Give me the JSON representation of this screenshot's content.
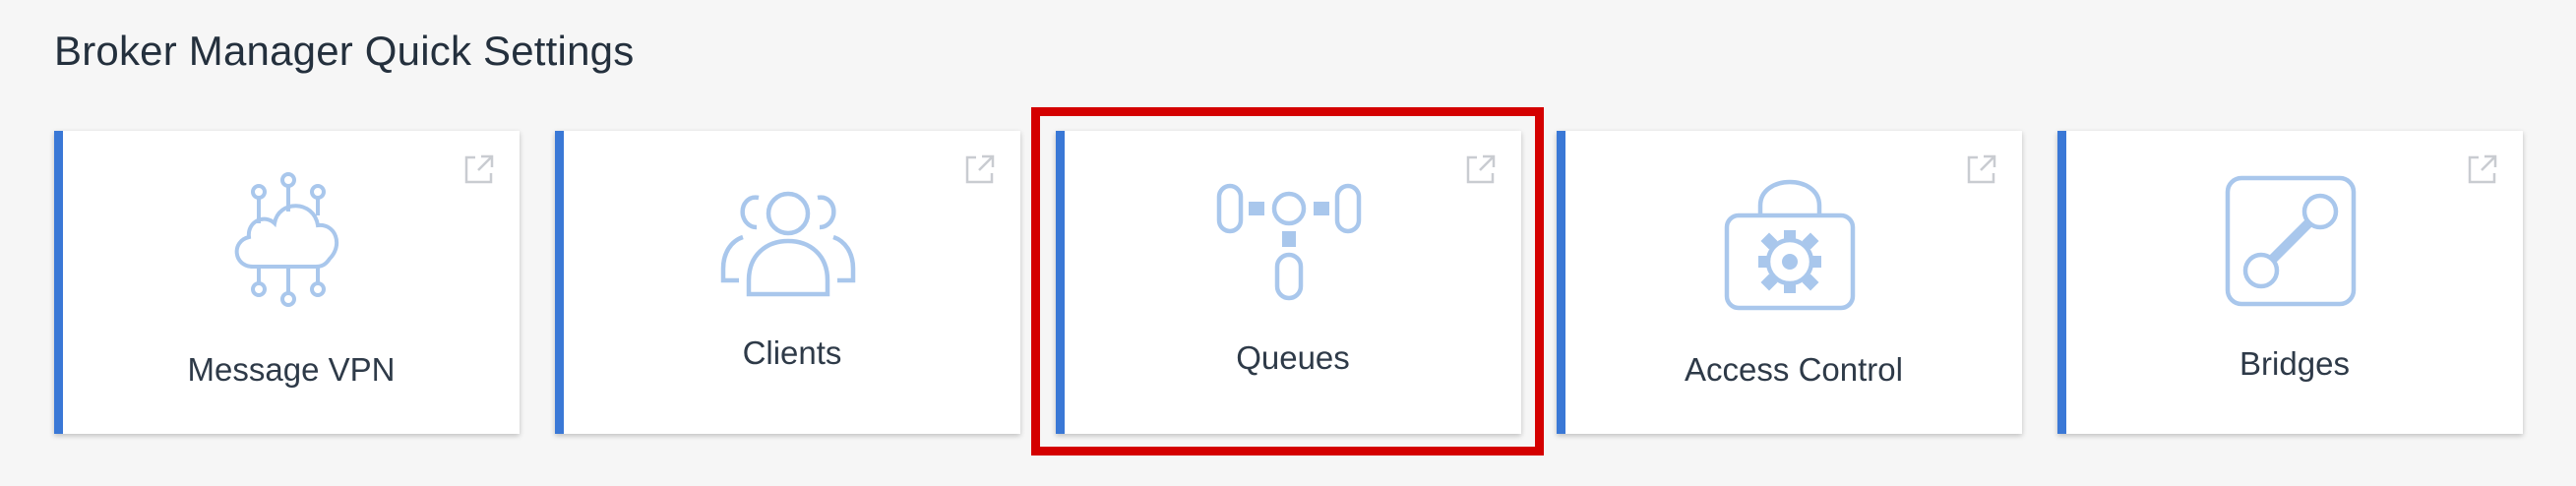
{
  "section": {
    "title": "Broker Manager Quick Settings"
  },
  "cards": [
    {
      "label": "Message VPN",
      "icon": "cloud-network-icon"
    },
    {
      "label": "Clients",
      "icon": "users-icon"
    },
    {
      "label": "Queues",
      "icon": "queue-nodes-icon"
    },
    {
      "label": "Access Control",
      "icon": "lock-gear-icon"
    },
    {
      "label": "Bridges",
      "icon": "bridge-link-icon"
    }
  ],
  "colors": {
    "accent": "#3a78d6",
    "icon": "#a9c7ec",
    "highlight": "#d40000",
    "background": "#f6f6f6"
  },
  "highlighted_card": "Queues"
}
